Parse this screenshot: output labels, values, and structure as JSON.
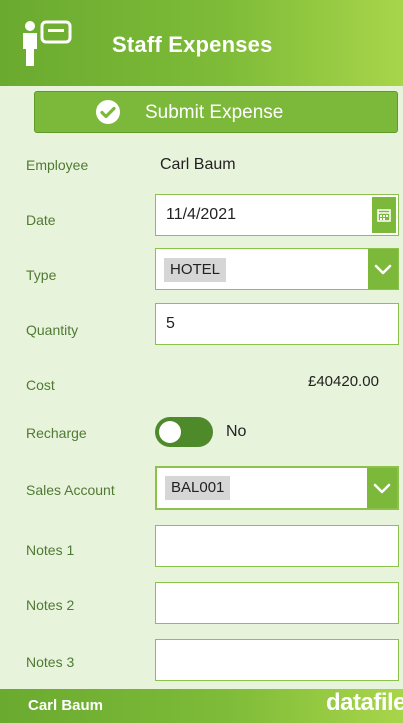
{
  "header": {
    "title": "Staff Expenses"
  },
  "submit": {
    "label": "Submit Expense"
  },
  "form": {
    "employee": {
      "label": "Employee",
      "value": "Carl Baum"
    },
    "date": {
      "label": "Date",
      "value": "11/4/2021"
    },
    "type": {
      "label": "Type",
      "value": "HOTEL"
    },
    "quantity": {
      "label": "Quantity",
      "value": "5"
    },
    "cost": {
      "label": "Cost",
      "value": "£40420.00"
    },
    "recharge": {
      "label": "Recharge",
      "state": "No"
    },
    "sales_account": {
      "label": "Sales Account",
      "value": "BAL001"
    },
    "notes1": {
      "label": "Notes 1",
      "value": ""
    },
    "notes2": {
      "label": "Notes 2",
      "value": ""
    },
    "notes3": {
      "label": "Notes 3",
      "value": ""
    }
  },
  "footer": {
    "user": "Carl Baum",
    "brand": "datafile"
  },
  "colors": {
    "header_green": "#7cb83a",
    "page_background": "#e8f3dc",
    "label_green": "#4f7a33",
    "toggle_dark": "#4e8a2a"
  },
  "icons": [
    "staff-card-icon",
    "checkmark-circle-icon",
    "calendar-icon",
    "chevron-down-icon"
  ]
}
